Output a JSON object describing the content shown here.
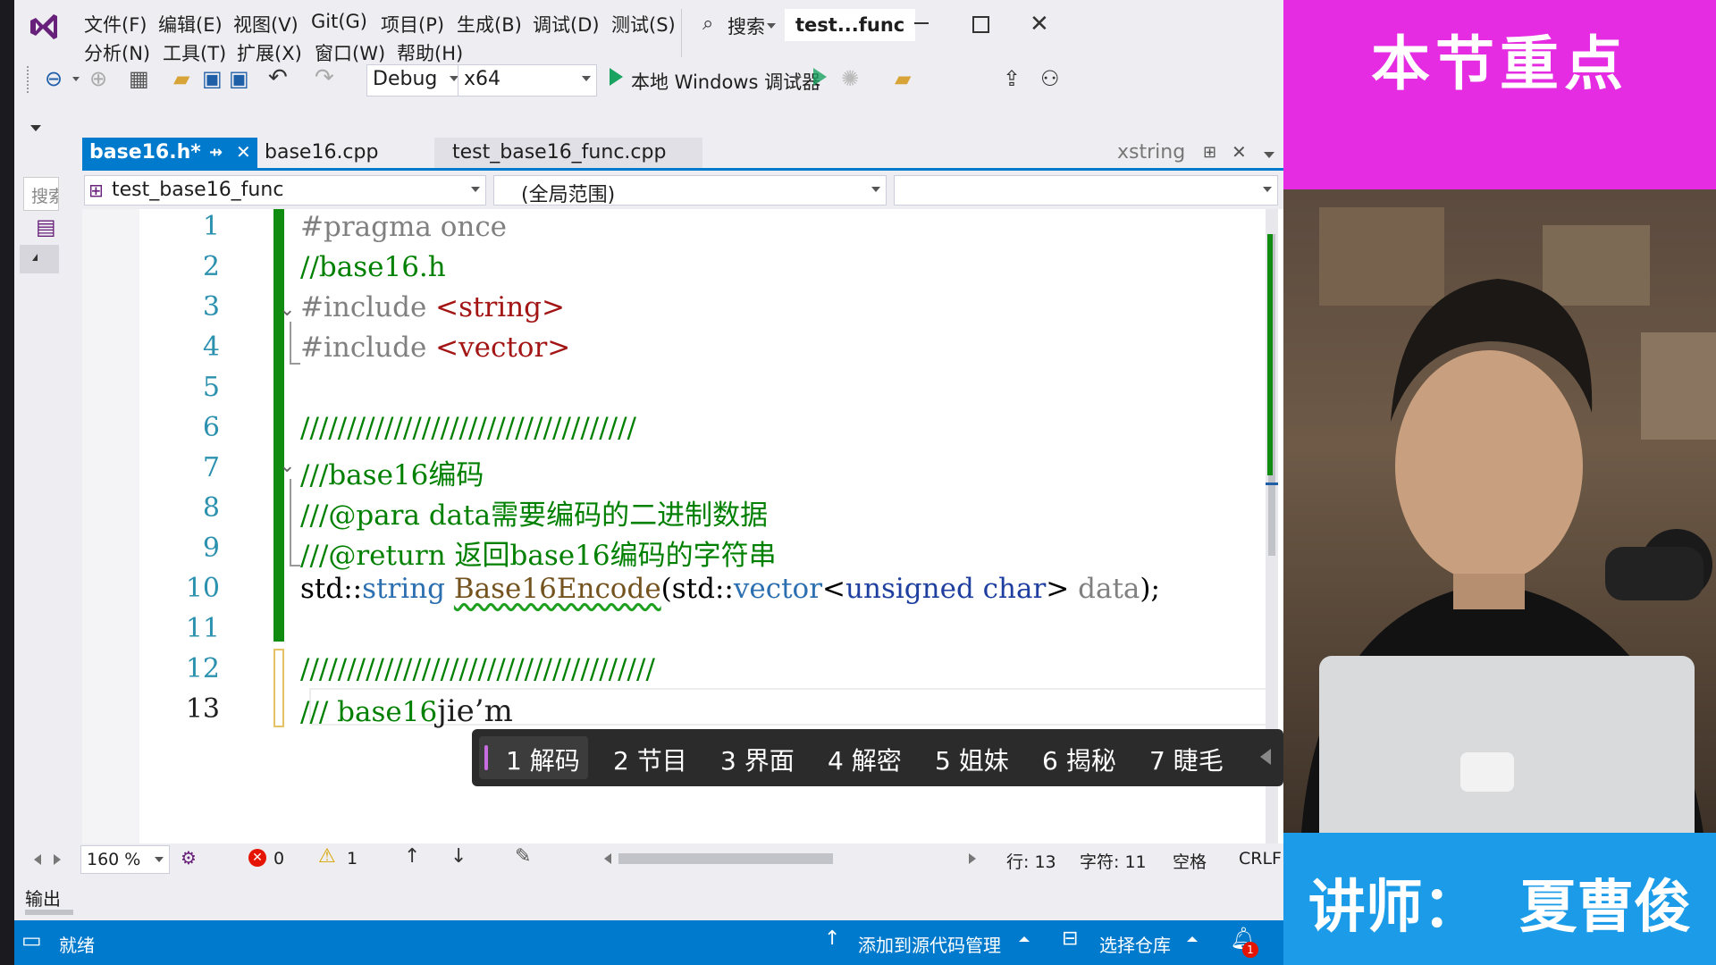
{
  "menu": {
    "row1": [
      "文件(F)",
      "编辑(E)",
      "视图(V)",
      "Git(G)",
      "项目(P)",
      "生成(B)",
      "调试(D)",
      "测试(S)"
    ],
    "row2": [
      "分析(N)",
      "工具(T)",
      "扩展(X)",
      "窗口(W)",
      "帮助(H)"
    ],
    "search_label": "搜索",
    "window_title": "test...func"
  },
  "toolbar": {
    "config": "Debug",
    "platform": "x64",
    "run_label": "本地 Windows 调试器"
  },
  "tabs": [
    {
      "label": "base16.h*",
      "active": true
    },
    {
      "label": "base16.cpp",
      "active": false
    },
    {
      "label": "test_base16_func.cpp",
      "active": false
    }
  ],
  "preview_tab": "xstring",
  "nav": {
    "project": "test_base16_func",
    "scope": "(全局范围)",
    "member": ""
  },
  "left_panel": {
    "search_hint": "搜索"
  },
  "code": {
    "line_numbers": [
      "1",
      "2",
      "3",
      "4",
      "5",
      "6",
      "7",
      "8",
      "9",
      "10",
      "11",
      "12",
      "13"
    ],
    "l1": "#pragma once",
    "l2": "//base16.h",
    "l3_a": "#include ",
    "l3_b": "<string>",
    "l4_a": "#include ",
    "l4_b": "<vector>",
    "l6": "////////////////////////////////////",
    "l7": "///base16编码",
    "l8": "///@para data需要编码的二进制数据",
    "l9": "///@return 返回base16编码的字符串",
    "l10_a": "std::",
    "l10_b": "string",
    "l10_c": " ",
    "l10_d": "Base16Encode",
    "l10_e": "(std::",
    "l10_f": "vector",
    "l10_g": "<",
    "l10_h": "unsigned char",
    "l10_i": "> ",
    "l10_j": "data",
    "l10_k": ");",
    "l12": "//////////////////////////////////////",
    "l13_a": "/// base16",
    "l13_b": "jie’m"
  },
  "ime_candidates": [
    "1 解码",
    "2 节目",
    "3 界面",
    "4 解密",
    "5 姐妹",
    "6 揭秘",
    "7 睫毛"
  ],
  "status_strip": {
    "zoom": "160 %",
    "errors": "0",
    "warnings": "1",
    "line": "行: 13",
    "char": "字符: 11",
    "spaces": "空格",
    "eol": "CRLF"
  },
  "output_label": "输出",
  "statusbar": {
    "ready": "就绪",
    "source_control": "添加到源代码管理",
    "repo": "选择仓库",
    "notifications": "1"
  },
  "overlay": {
    "top_title": "本节重点",
    "instructor": "讲师：  夏曹俊"
  },
  "colors": {
    "accent": "#007acc",
    "magenta": "#e62ce3",
    "instructor_bg": "#1c9ce8"
  }
}
